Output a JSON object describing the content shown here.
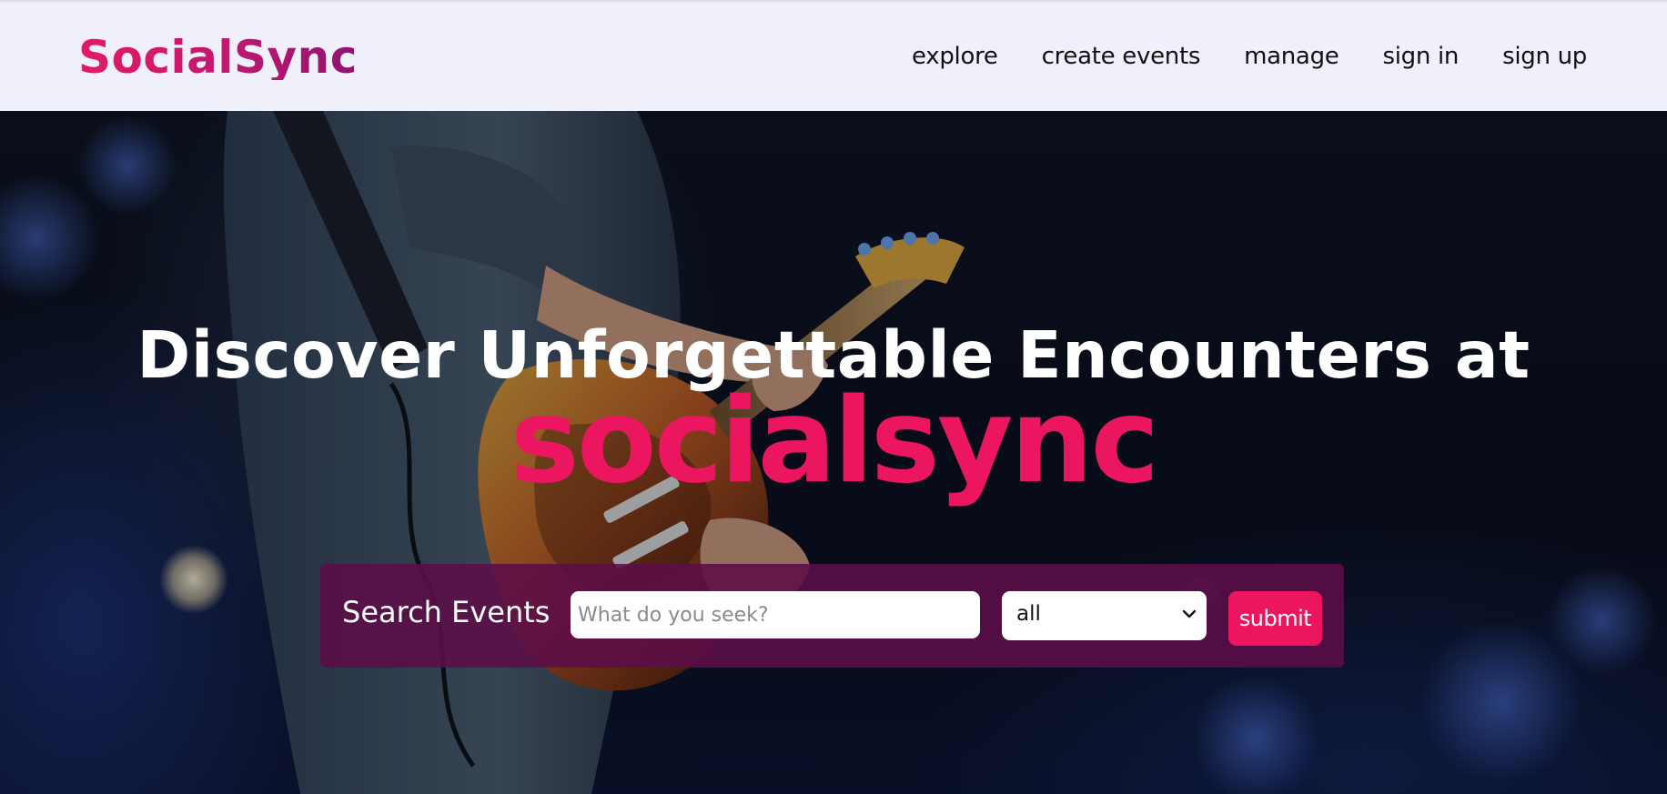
{
  "header": {
    "brand": "SocialSync",
    "nav": [
      {
        "label": "explore"
      },
      {
        "label": "create events"
      },
      {
        "label": "manage"
      },
      {
        "label": "sign in"
      },
      {
        "label": "sign up"
      }
    ]
  },
  "hero": {
    "title": "Discover Unforgettable Encounters at",
    "brand": "socialsync",
    "background_image": "guitarist-on-stage-photo"
  },
  "search": {
    "label": "Search Events",
    "placeholder": "What do you seek?",
    "value": "",
    "category_selected": "all",
    "submit_label": "submit"
  },
  "colors": {
    "accent": "#ec1660",
    "brand_gradient_end": "#8e1470",
    "panel": "#5c0e48",
    "nav_bg": "#f0f0fa"
  }
}
